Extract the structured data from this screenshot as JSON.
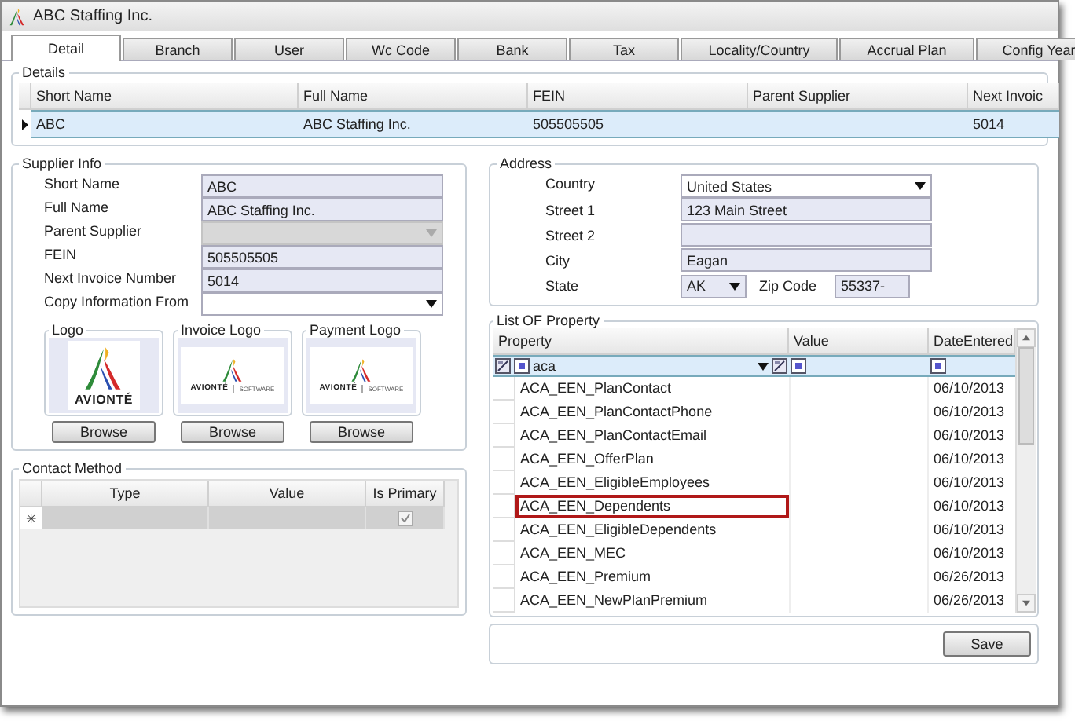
{
  "window": {
    "title": "ABC Staffing Inc."
  },
  "tabs": [
    {
      "label": "Detail",
      "selected": true
    },
    {
      "label": "Branch",
      "selected": false
    },
    {
      "label": "User",
      "selected": false
    },
    {
      "label": "Wc Code",
      "selected": false
    },
    {
      "label": "Bank",
      "selected": false
    },
    {
      "label": "Tax",
      "selected": false
    },
    {
      "label": "Locality/Country",
      "selected": false
    },
    {
      "label": "Accrual Plan",
      "selected": false
    },
    {
      "label": "Config Year",
      "selected": false
    }
  ],
  "details": {
    "title": "Details",
    "columns": [
      "Short Name",
      "Full Name",
      "FEIN",
      "Parent Supplier",
      "Next Invoic"
    ],
    "rows": [
      {
        "cells": [
          "ABC",
          "ABC Staffing Inc.",
          "505505505",
          null,
          "5014"
        ],
        "selected": true
      }
    ]
  },
  "supplier_info": {
    "title": "Supplier Info",
    "fields": [
      {
        "label": "Short Name",
        "kind": "text",
        "value": "ABC"
      },
      {
        "label": "Full Name",
        "kind": "text",
        "value": "ABC Staffing Inc."
      },
      {
        "label": "Parent Supplier",
        "kind": "dropdown",
        "disabled": true
      },
      {
        "label": "FEIN",
        "kind": "text",
        "value": "505505505"
      },
      {
        "label": "Next Invoice Number",
        "kind": "text",
        "value": "5014"
      },
      {
        "label": "Copy Information From",
        "kind": "dropdown",
        "disabled": false
      }
    ],
    "logos": [
      {
        "title": "Logo",
        "kind": "large",
        "logo_text": "AVIONTÉ",
        "button": "Browse"
      },
      {
        "title": "Invoice Logo",
        "kind": "wide",
        "logo_text": "AVIONTÉ",
        "tagline": "SOFTWARE",
        "button": "Browse"
      },
      {
        "title": "Payment Logo",
        "kind": "wide",
        "logo_text": "AVIONTÉ",
        "tagline": "SOFTWARE",
        "button": "Browse"
      }
    ]
  },
  "contact_method": {
    "title": "Contact Method",
    "columns": [
      "Type",
      "Value",
      "Is Primary"
    ],
    "new_row": {
      "marker": "✳",
      "is_primary_checked": true
    }
  },
  "address": {
    "title": "Address",
    "fields": [
      {
        "label": "Country",
        "kind": "dropdown",
        "value": "United States"
      },
      {
        "label": "Street 1",
        "kind": "text",
        "value": "123 Main Street"
      },
      {
        "label": "Street 2",
        "kind": "text"
      },
      {
        "label": "City",
        "kind": "text",
        "value": "Eagan"
      }
    ],
    "state": {
      "label": "State",
      "value": "AK"
    },
    "zip": {
      "label": "Zip Code",
      "value": "55337-"
    }
  },
  "property_list": {
    "title": "List OF Property",
    "columns": [
      "Property",
      "Value",
      "DateEntered"
    ],
    "filter": {
      "value": "aca"
    },
    "rows": [
      {
        "property": "ACA_EEN_PlanContact",
        "date": "06/10/2013",
        "highlighted": false
      },
      {
        "property": "ACA_EEN_PlanContactPhone",
        "date": "06/10/2013",
        "highlighted": false
      },
      {
        "property": "ACA_EEN_PlanContactEmail",
        "date": "06/10/2013",
        "highlighted": false
      },
      {
        "property": "ACA_EEN_OfferPlan",
        "date": "06/10/2013",
        "highlighted": false
      },
      {
        "property": "ACA_EEN_EligibleEmployees",
        "date": "06/10/2013",
        "highlighted": false
      },
      {
        "property": "ACA_EEN_Dependents",
        "date": "06/10/2013",
        "highlighted": true
      },
      {
        "property": "ACA_EEN_EligibleDependents",
        "date": "06/10/2013",
        "highlighted": false
      },
      {
        "property": "ACA_EEN_MEC",
        "date": "06/10/2013",
        "highlighted": false
      },
      {
        "property": "ACA_EEN_Premium",
        "date": "06/26/2013",
        "highlighted": false
      },
      {
        "property": "ACA_EEN_NewPlanPremium",
        "date": "06/26/2013",
        "highlighted": false
      }
    ]
  },
  "save_button": "Save"
}
